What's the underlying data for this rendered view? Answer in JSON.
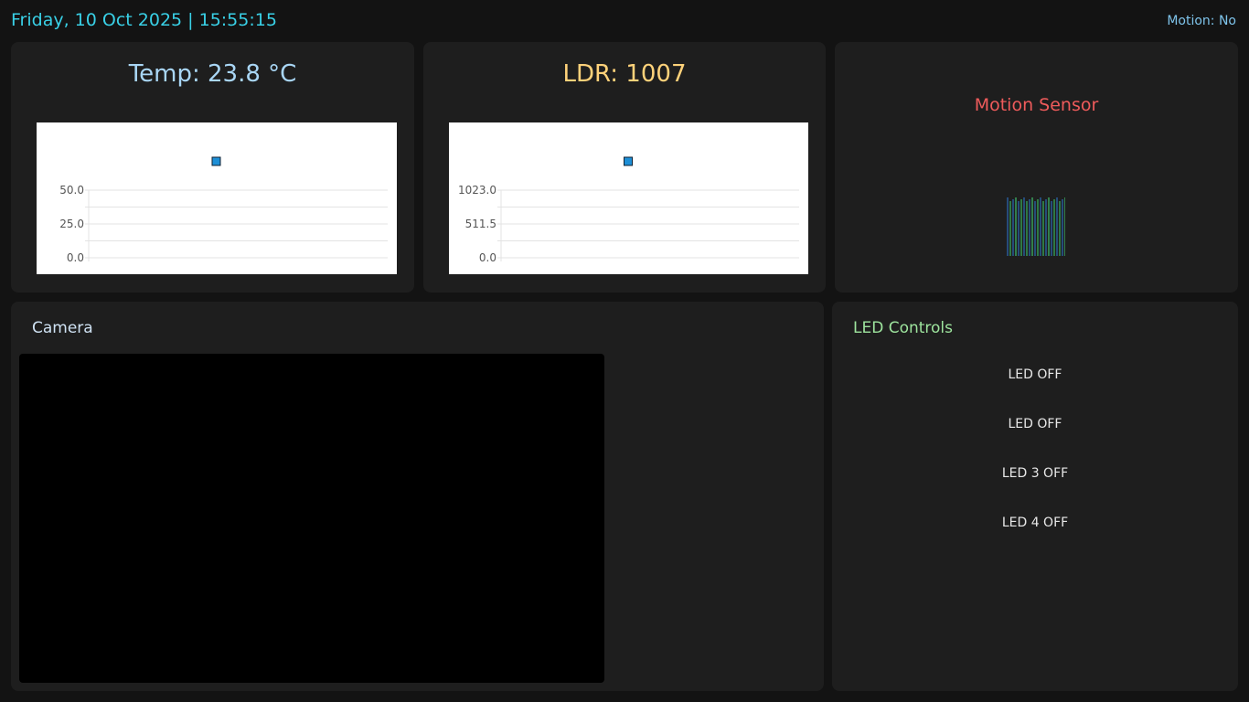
{
  "header": {
    "datetime": "Friday, 10 Oct 2025 | 15:55:15",
    "motion_status": "Motion: No"
  },
  "temperature": {
    "title": "Temp: 23.8 °C"
  },
  "ldr": {
    "title": "LDR: 1007"
  },
  "motion": {
    "title": "Motion Sensor"
  },
  "camera": {
    "title": "Camera"
  },
  "led_controls": {
    "title": "LED Controls",
    "buttons": [
      "LED OFF",
      "LED OFF",
      "LED 3 OFF",
      "LED 4 OFF"
    ]
  },
  "colors": {
    "datetime": "#39d0e6",
    "temp_title": "#a9d6f5",
    "ldr_title": "#ffd27a",
    "motion_title": "#ef5b5b",
    "led_title": "#9ee59e",
    "chart_marker": "#1e8fd6"
  },
  "chart_data": [
    {
      "type": "line",
      "title": "",
      "ylim": [
        0,
        50
      ],
      "yticks": [
        "50.0",
        "25.0",
        "0.0"
      ],
      "grid": true,
      "series": [
        {
          "values": []
        }
      ],
      "legend": "top-center"
    },
    {
      "type": "line",
      "title": "",
      "ylim": [
        0,
        1023
      ],
      "yticks": [
        "1023.0",
        "511.5",
        "0.0"
      ],
      "grid": true,
      "series": [
        {
          "values": []
        }
      ],
      "legend": "top-center"
    }
  ]
}
